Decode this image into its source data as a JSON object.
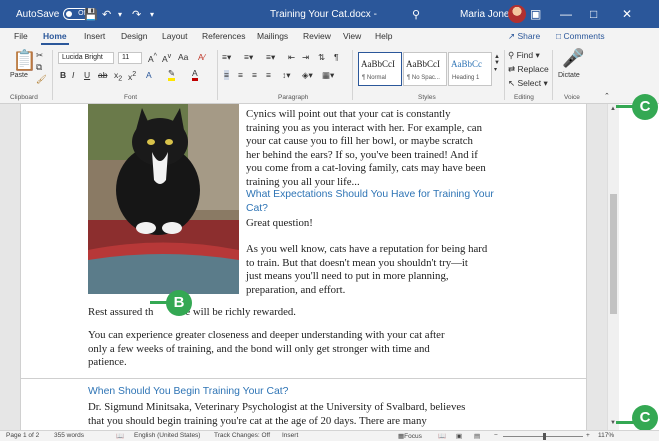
{
  "titlebar": {
    "autosave_label": "AutoSave",
    "autosave_state": "Off",
    "document_title": "Training Your Cat.docx",
    "app_suffix": "-",
    "user_name": "Maria Jones",
    "minimize": "—",
    "maximize": "□",
    "close": "✕"
  },
  "tabs": [
    "File",
    "Home",
    "Insert",
    "Design",
    "Layout",
    "References",
    "Mailings",
    "Review",
    "View",
    "Help"
  ],
  "active_tab": "Home",
  "ribbon_right": {
    "share": "Share",
    "comments": "Comments"
  },
  "ribbon": {
    "clipboard": {
      "label": "Clipboard",
      "paste": "Paste"
    },
    "font": {
      "label": "Font",
      "font_name": "Lucida Bright",
      "font_size": "11"
    },
    "paragraph": {
      "label": "Paragraph"
    },
    "styles": {
      "label": "Styles",
      "items": [
        {
          "preview": "AaBbCcI",
          "name": "¶ Normal"
        },
        {
          "preview": "AaBbCcI",
          "name": "¶ No Spac..."
        },
        {
          "preview": "AaBbCc",
          "name": "Heading 1"
        }
      ]
    },
    "editing": {
      "label": "Editing",
      "find": "Find",
      "replace": "Replace",
      "select": "Select"
    },
    "voice": {
      "label": "Voice",
      "dictate": "Dictate"
    }
  },
  "document": {
    "lines_right": [
      "Cynics will point out that your cat is constantly",
      "training you as you interact with her. For example, can",
      "your cat cause you to fill her bowl, or maybe scratch",
      "her behind the ears? If so, you've been trained! And if",
      "you come from a cat-loving family, cats may have been",
      "training you all your life..."
    ],
    "heading1_lines": [
      "What Expectations Should You Have for Training Your",
      "Cat?"
    ],
    "great_question": "Great question!",
    "para2_lines": [
      "As you well know, cats have a reputation for being hard",
      "to train. But that doesn't mean you shouldn't try—it",
      "just means you'll need to put in more planning,",
      "preparation, and effort."
    ],
    "rest_assured_start": "Rest assured th",
    "rest_assured_end": "e will be richly rewarded.",
    "para3_lines": [
      "You can experience greater closeness and deeper understanding with your cat after",
      "only a few weeks of training, and the bond will only get stronger with time and",
      "patience."
    ],
    "heading2": "When Should You Begin Training Your Cat?",
    "para4_lines": [
      "Dr. Sigmund Minitsaka, Veterinary Psychologist at the University of Svalbard, believes",
      "that you should begin training you're cat at the age of 20 days. There are many"
    ]
  },
  "status": {
    "page": "Page 1 of 2",
    "words": "355 words",
    "language": "English (United States)",
    "track_changes": "Track Changes: Off",
    "insert": "Insert",
    "focus": "Focus",
    "zoom": "117%"
  },
  "callouts": {
    "b": "B",
    "c_top": "C",
    "c_bottom": "C"
  },
  "colors": {
    "word_blue": "#2b579a",
    "callout_green": "#34a853",
    "heading_blue": "#2e74b5"
  }
}
